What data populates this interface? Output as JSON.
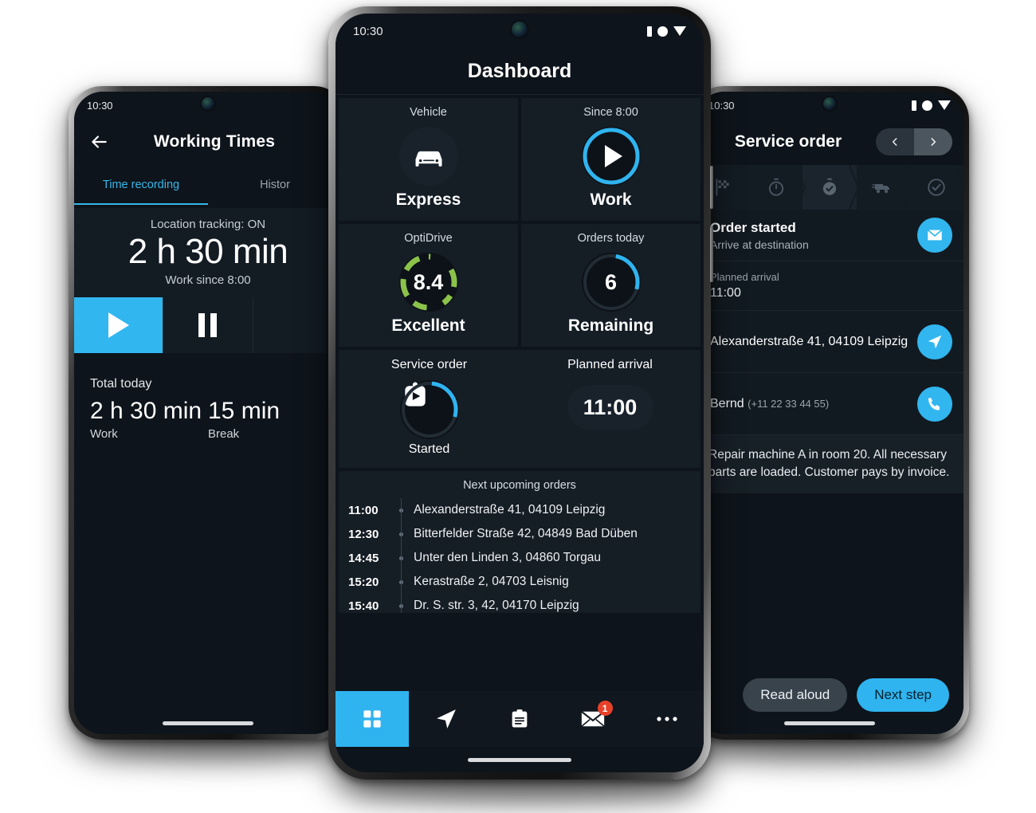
{
  "colors": {
    "accent_blue": "#2FB4EF",
    "green": "#8BC34A",
    "badge_red": "#E8412A",
    "screen_bg": "#0E141B",
    "card_bg": "#151D25"
  },
  "left_phone": {
    "statusbar": {
      "time": "10:30"
    },
    "appbar": {
      "back_icon": "arrow-left-icon",
      "title": "Working Times"
    },
    "tabs": [
      {
        "label": "Time recording",
        "active": true
      },
      {
        "label": "Histor",
        "active": false
      }
    ],
    "timer_card": {
      "location_tracking": "Location tracking: ON",
      "duration": "2 h 30 min",
      "since": "Work since 8:00"
    },
    "controls": [
      {
        "icon": "play-icon",
        "active": true
      },
      {
        "icon": "pause-icon",
        "active": false
      }
    ],
    "totals": {
      "heading": "Total today",
      "items": [
        {
          "value": "2 h 30 min",
          "label": "Work"
        },
        {
          "value": "15 min",
          "label": "Break"
        }
      ]
    }
  },
  "center_phone": {
    "statusbar": {
      "time": "10:30",
      "icons": [
        "signal-icon",
        "circle-icon",
        "dropdown-icon"
      ]
    },
    "title": "Dashboard",
    "cards": [
      {
        "caption": "Vehicle",
        "icon": "car-icon",
        "value": "Express"
      },
      {
        "caption": "Since 8:00",
        "icon": "play-icon",
        "value": "Work",
        "ring": "blue-full"
      },
      {
        "caption": "OptiDrive",
        "icon": "gauge",
        "number": "8.4",
        "value": "Excellent",
        "ring": "green-dashed"
      },
      {
        "caption": "Orders today",
        "icon": "gauge",
        "number": "6",
        "value": "Remaining",
        "ring": "blue-partial"
      }
    ],
    "wide_card": {
      "left": {
        "caption": "Service order",
        "icon": "clipboard-play-icon",
        "value": "Started"
      },
      "right": {
        "caption": "Planned arrival",
        "time": "11:00"
      }
    },
    "upcoming": {
      "caption": "Next upcoming orders",
      "rows": [
        {
          "time": "11:00",
          "address": "Alexanderstraße 41, 04109 Leipzig"
        },
        {
          "time": "12:30",
          "address": "Bitterfelder Straße 42, 04849 Bad Düben"
        },
        {
          "time": "14:45",
          "address": "Unter den Linden 3, 04860 Torgau"
        },
        {
          "time": "15:20",
          "address": "Kerastraße 2, 04703 Leisnig"
        },
        {
          "time": "15:40",
          "address": "Dr. S. str. 3, 42, 04170 Leipzig"
        }
      ]
    },
    "navbar": [
      {
        "icon": "grid-icon",
        "active": true,
        "badge": ""
      },
      {
        "icon": "navigation-arrow-icon",
        "active": false,
        "badge": ""
      },
      {
        "icon": "clipboard-icon",
        "active": false,
        "badge": ""
      },
      {
        "icon": "envelope-icon",
        "active": false,
        "badge": "1"
      },
      {
        "icon": "more-dots-icon",
        "active": false,
        "badge": ""
      }
    ]
  },
  "right_phone": {
    "statusbar": {
      "time": "10:30"
    },
    "appbar": {
      "title": "Service order",
      "prev_icon": "chevron-left-icon",
      "next_icon": "chevron-right-icon"
    },
    "steps": [
      {
        "icon": "checkered-flag-icon",
        "state": "done"
      },
      {
        "icon": "timer-icon",
        "state": "done"
      },
      {
        "icon": "stopwatch-check-icon",
        "state": "current"
      },
      {
        "icon": "truck-icon",
        "state": "upcoming"
      },
      {
        "icon": "check-circle-icon",
        "state": "upcoming"
      }
    ],
    "rows": [
      {
        "title": "Order started",
        "sub": "Arrive at destination",
        "action_icon": "envelope-icon"
      },
      {
        "title": "Planned arrival",
        "sub": "11:00",
        "action_icon": ""
      },
      {
        "text": "Alexanderstraße 41, 04109 Leipzig",
        "action_icon": "navigation-arrow-icon"
      },
      {
        "text": "Bernd",
        "meta": "(+11 22 33 44 55)",
        "action_icon": "phone-icon"
      }
    ],
    "note": "Repair machine A in room 20. All necessary parts are loaded. Customer pays by invoice.",
    "buttons": [
      {
        "label": "Read aloud",
        "style": "grey"
      },
      {
        "label": "Next step",
        "style": "blue"
      }
    ]
  }
}
